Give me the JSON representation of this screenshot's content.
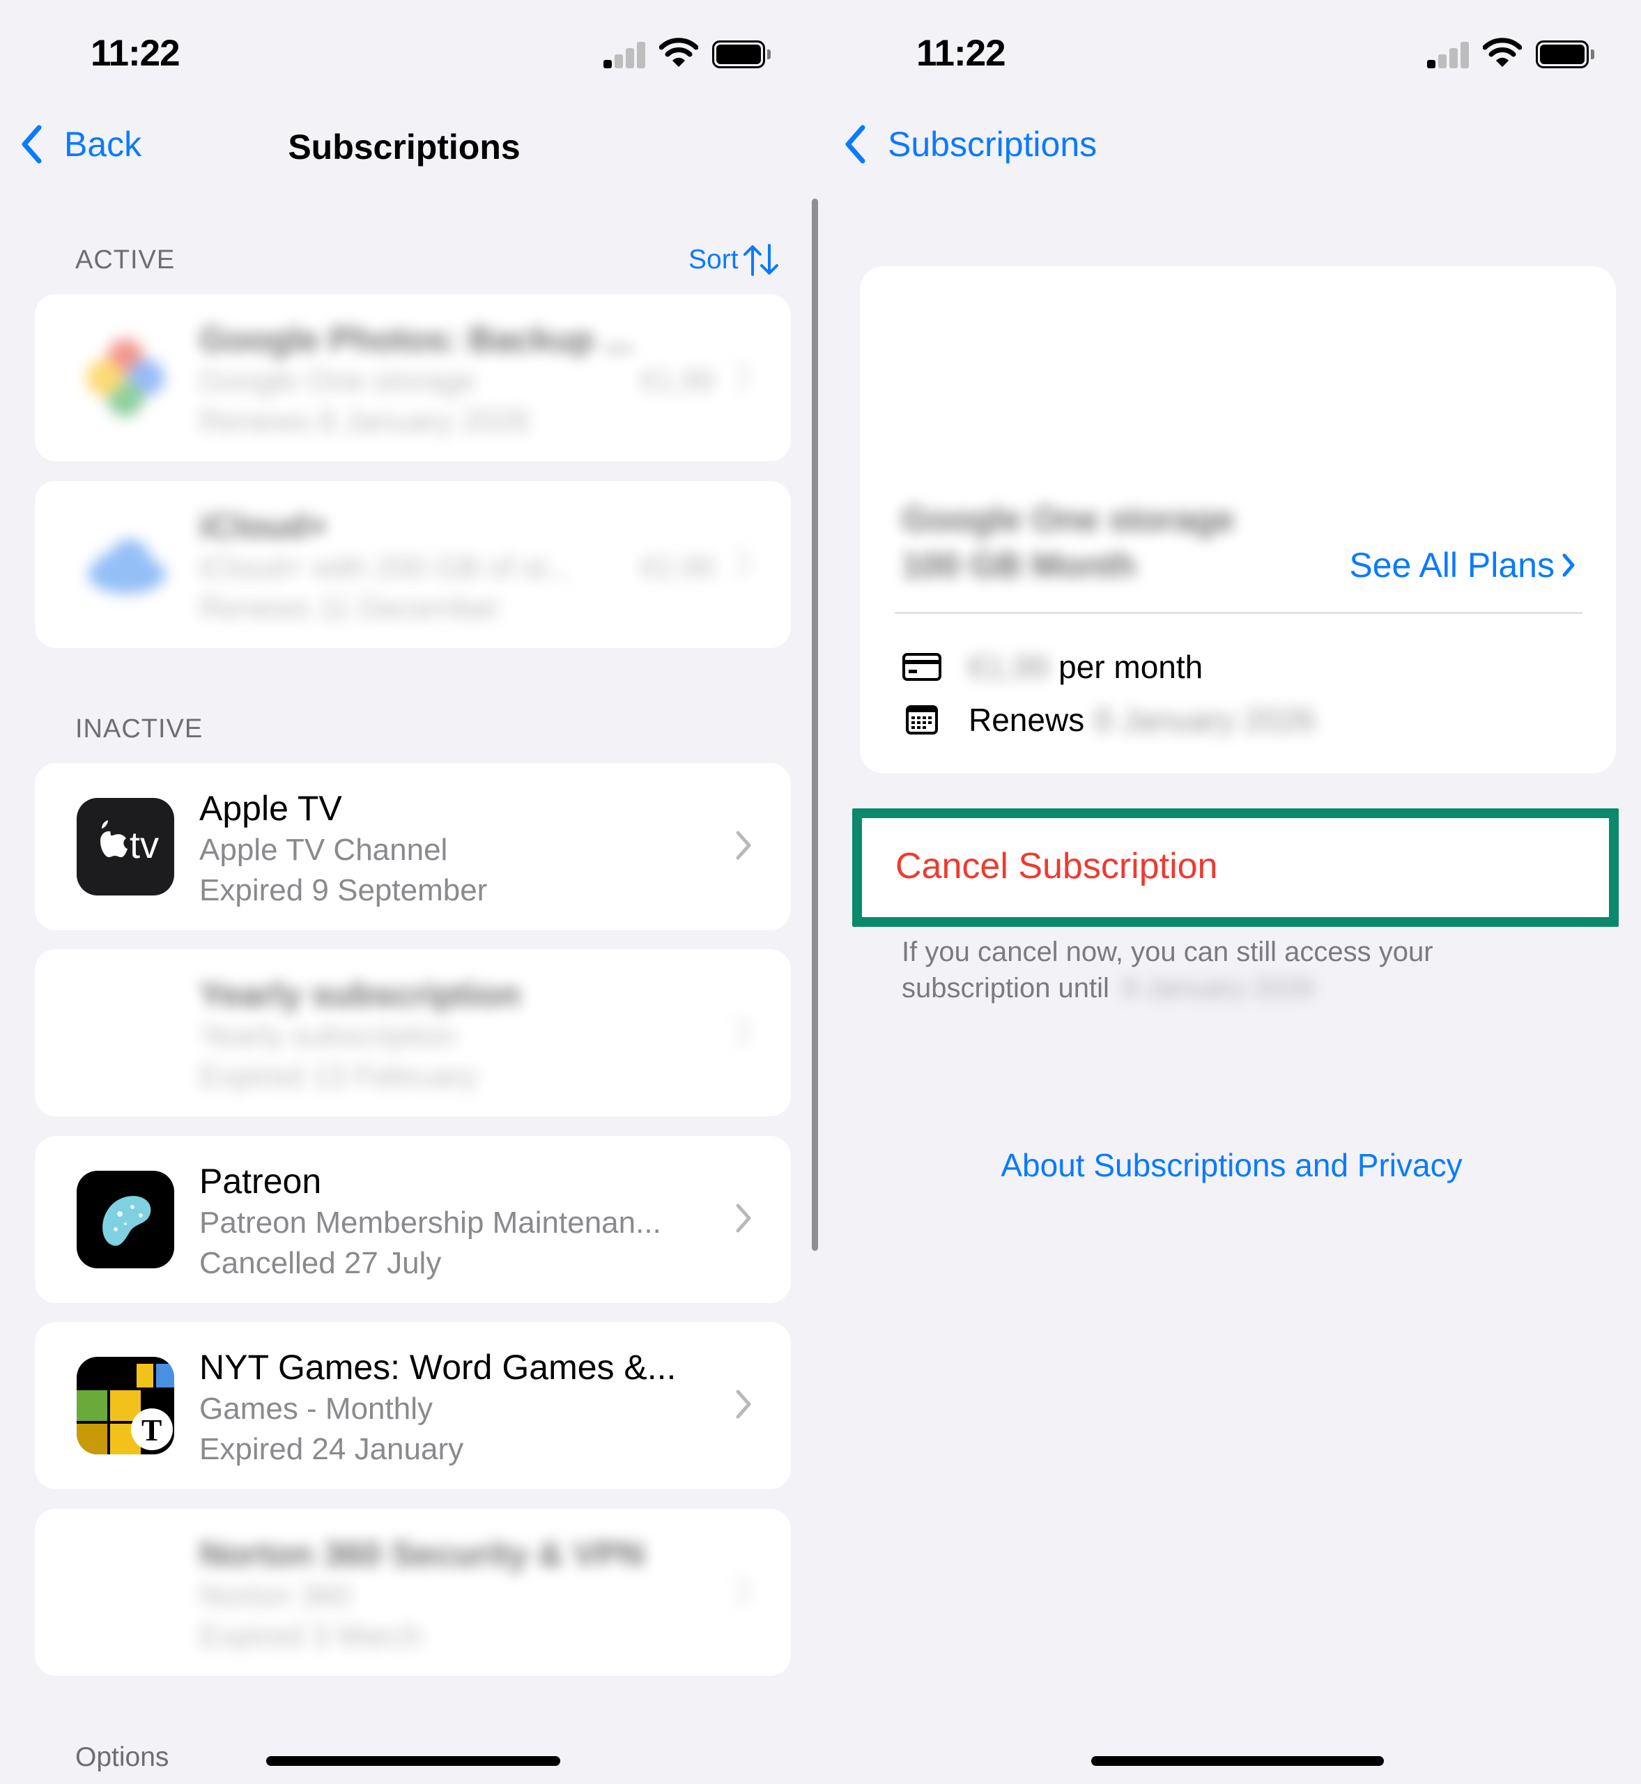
{
  "status_bar": {
    "time": "11:22"
  },
  "left": {
    "nav": {
      "back_label": "Back",
      "title": "Subscriptions"
    },
    "active": {
      "header": "ACTIVE",
      "sort_label": "Sort",
      "items": [
        {
          "title": "Google Photos: Backup ...",
          "subtitle": "Google One storage",
          "status": "Renews 8 January 2026",
          "price": "€1,99"
        },
        {
          "title": "iCloud+",
          "subtitle": "iCloud+ with 200 GB of st...",
          "status": "Renews 11 December",
          "price": "€2,99"
        }
      ]
    },
    "inactive": {
      "header": "INACTIVE",
      "items": [
        {
          "title": "Apple TV",
          "subtitle": "Apple TV Channel",
          "status": "Expired 9 September"
        },
        {
          "title": "Yearly subscription",
          "subtitle": "Yearly subscription",
          "status": "Expired 13 February"
        },
        {
          "title": "Patreon",
          "subtitle": "Patreon Membership Maintenan...",
          "status": "Cancelled 27 July"
        },
        {
          "title": "NYT Games: Word Games &...",
          "subtitle": "Games - Monthly",
          "status": "Expired 24 January"
        },
        {
          "title": "Norton 360 Security & VPN",
          "subtitle": "Norton 360",
          "status": "Expired 3 March"
        }
      ]
    },
    "options_label": "Options"
  },
  "right": {
    "nav": {
      "back_label": "Subscriptions"
    },
    "plan": {
      "name_line1": "Google One storage",
      "name_line2": "100 GB Month",
      "see_all_label": "See All Plans",
      "price_amount": "€1,99",
      "price_suffix": "per month",
      "renews_label": "Renews",
      "renews_date": "8 January 2026"
    },
    "cancel_label": "Cancel Subscription",
    "cancel_note": "If you cancel now, you can still access your subscription until",
    "cancel_until": "8 January 2026",
    "about_link": "About Subscriptions and Privacy"
  },
  "colors": {
    "accent": "#0a7aff",
    "destructive": "#ef3a2f",
    "highlight": "#0a8a6a",
    "background": "#f2f2f7"
  },
  "icons": {
    "back": "chevron-left-icon",
    "sort": "sort-arrows-icon",
    "row": "chevron-right-icon",
    "payment": "credit-card-icon",
    "renew": "calendar-icon"
  }
}
